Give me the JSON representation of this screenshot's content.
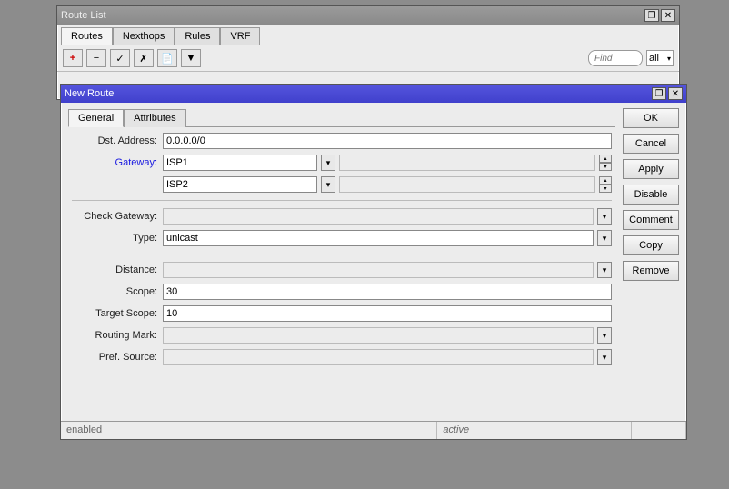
{
  "route_list": {
    "title": "Route List",
    "tabs": [
      "Routes",
      "Nexthops",
      "Rules",
      "VRF"
    ],
    "find_placeholder": "Find",
    "filter_all": "all"
  },
  "new_route": {
    "title": "New Route",
    "tabs": {
      "general": "General",
      "attributes": "Attributes"
    },
    "labels": {
      "dst": "Dst. Address:",
      "gateway": "Gateway:",
      "check_gw": "Check Gateway:",
      "type": "Type:",
      "distance": "Distance:",
      "scope": "Scope:",
      "target_scope": "Target Scope:",
      "routing_mark": "Routing Mark:",
      "pref_source": "Pref. Source:"
    },
    "values": {
      "dst": "0.0.0.0/0",
      "gateway1": "ISP1",
      "gateway2": "ISP2",
      "check_gw": "",
      "type": "unicast",
      "distance": "",
      "scope": "30",
      "target_scope": "10",
      "routing_mark": "",
      "pref_source": ""
    },
    "buttons": {
      "ok": "OK",
      "cancel": "Cancel",
      "apply": "Apply",
      "disable": "Disable",
      "comment": "Comment",
      "copy": "Copy",
      "remove": "Remove"
    },
    "status": {
      "enabled": "enabled",
      "active": "active"
    }
  }
}
